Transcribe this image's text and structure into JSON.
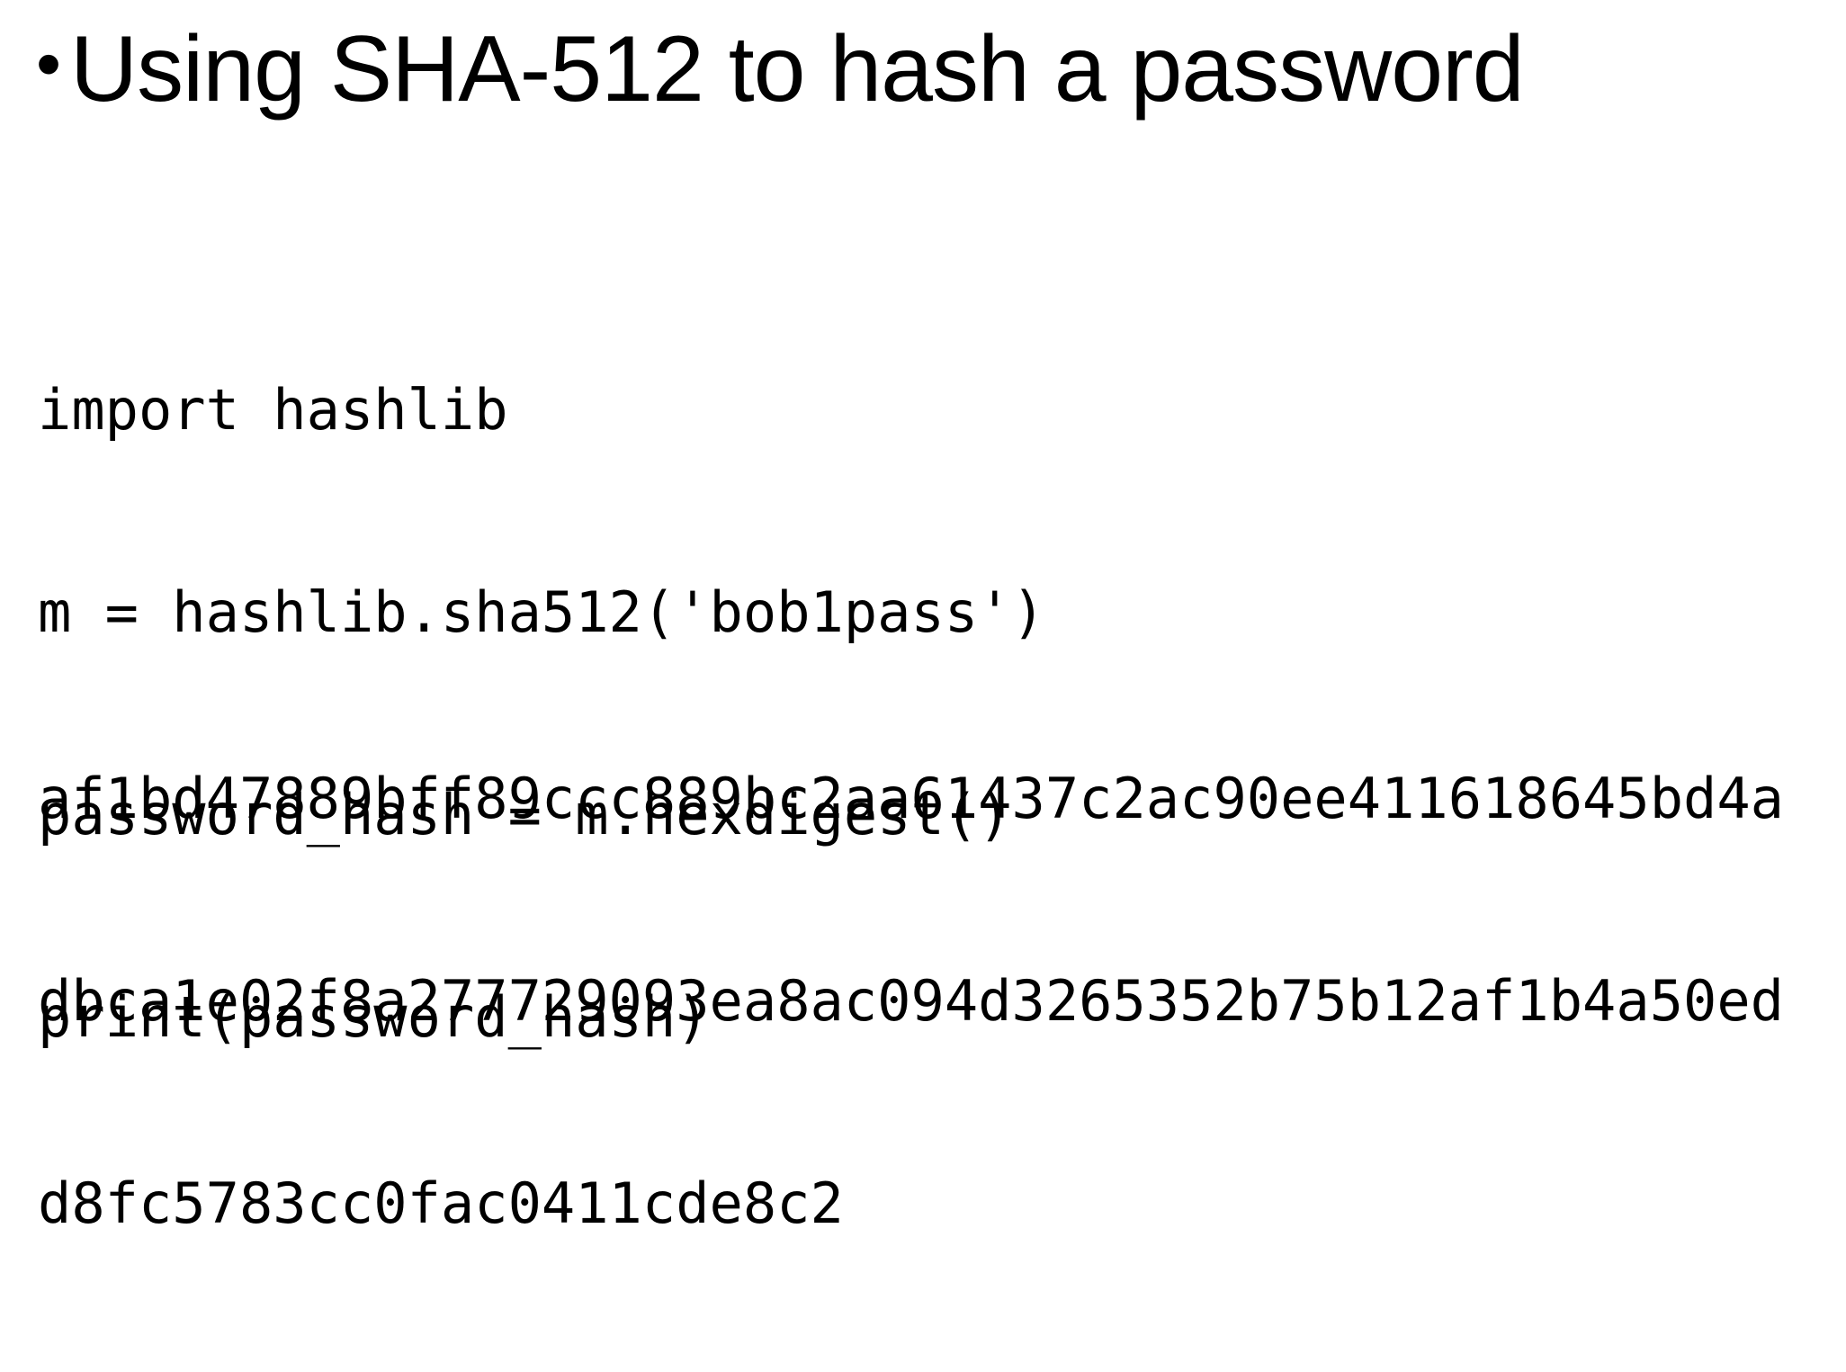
{
  "slide": {
    "bullet_symbol": "•",
    "heading": "Using SHA-512 to hash a password",
    "code_lines": [
      "import hashlib",
      "m = hashlib.sha512('bob1pass')",
      "password_hash = m.hexdigest()",
      "print(password_hash)"
    ],
    "output_lines": [
      "af1bd47889bff89ccc889bc2aa61437c2ac90ee411618645bd4a",
      "dbca1e02f8a277729093ea8ac094d3265352b75b12af1b4a50ed",
      "d8fc5783cc0fac0411cde8c2"
    ]
  }
}
